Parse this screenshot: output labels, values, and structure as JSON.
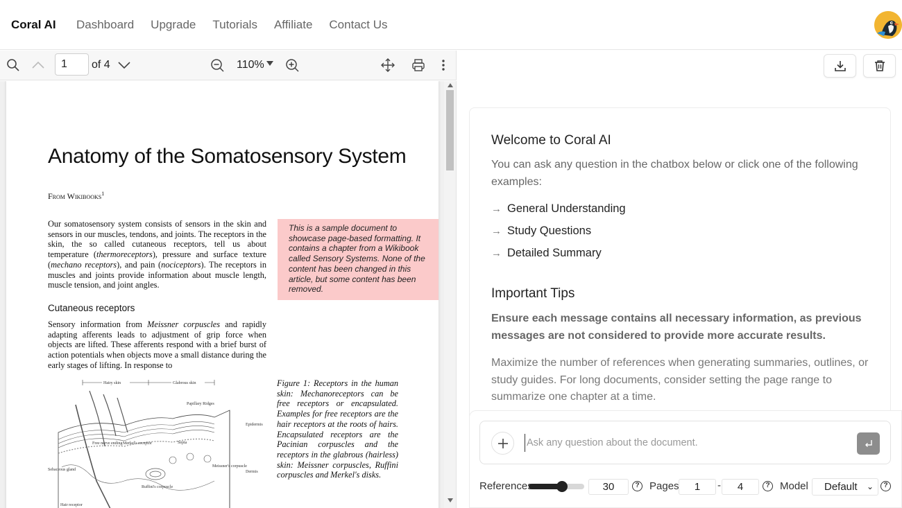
{
  "nav": {
    "brand": "Coral AI",
    "links": [
      "Dashboard",
      "Upgrade",
      "Tutorials",
      "Affiliate",
      "Contact Us"
    ]
  },
  "pdf_toolbar": {
    "page_value": "1",
    "page_total": "of 4",
    "zoom": "110%"
  },
  "document": {
    "title": "Anatomy of the Somatosensory System",
    "from": "From Wikibooks",
    "from_note": "1",
    "para1_a": "Our somatosensory system consists of sensors in the skin and sensors in our muscles, tendons, and joints. The receptors in the skin, the so called cutaneous receptors, tell us about temperature (",
    "para1_b": "thermoreceptors",
    "para1_c": "), pressure and surface texture (",
    "para1_d": "mechano receptors",
    "para1_e": "), and pain (",
    "para1_f": "nociceptors",
    "para1_g": "). The receptors in muscles and joints provide information about muscle length, muscle tension, and joint angles.",
    "heading": "Cutaneous receptors",
    "para2_a": "Sensory information from ",
    "para2_b": "Meissner corpuscles",
    "para2_c": " and rapidly adapting afferents leads to adjustment of grip force when objects are lifted. These afferents respond with a brief burst of action potentials when objects move a small distance during the early stages of lifting. In response to",
    "note": "This is a sample document to showcase page-based formatting. It contains a chapter from a Wikibook called Sensory Systems. None of the content has been changed in this article, but some content has been removed.",
    "caption": "Figure 1: Receptors in the human skin: Mechanoreceptors can be free receptors or encapsulated. Examples for free receptors are the hair receptors at the roots of hairs. Encapsulated receptors are the Pacinian corpuscles and the receptors in the glabrous (hairless) skin: Meissner corpuscles, Ruffini corpuscles and Merkel's disks.",
    "figure_labels": {
      "hairy": "Hairy skin",
      "glabrous": "Glabrous skin",
      "papillary": "Papillary Ridges",
      "free_nerve": "Free nerve ending",
      "merkel": "Merkel's receptor",
      "septa": "Septa",
      "epidermis": "Epidermis",
      "dermis": "Dermis",
      "meissner": "Meissner's corpuscle",
      "ruffini": "Ruffini's corpuscle",
      "sebaceous": "Sebaceous gland",
      "hair_receptor": "Hair receptor"
    }
  },
  "welcome": {
    "title": "Welcome to Coral AI",
    "subtitle": "You can ask any question in the chatbox below or click one of the following examples:",
    "examples": [
      "General Understanding",
      "Study Questions",
      "Detailed Summary"
    ],
    "tips_title": "Important Tips",
    "tip1": "Ensure each message contains all necessary information, as previous messages are not considered to provide more accurate results.",
    "tip2": "Maximize the number of references when generating summaries, outlines, or study guides. For long documents, consider setting the page range to summarize one chapter at a time."
  },
  "composer": {
    "placeholder": "Ask any question about the document.",
    "references_label": "References",
    "references_value": "30",
    "references_level": 0.6,
    "pages_label": "Pages",
    "page_from": "1",
    "page_to": "4",
    "model_label": "Model",
    "model_value": "Default"
  },
  "colors": {
    "note_bg": "#fbcaca",
    "avatar_bg": "#f2b531",
    "send_bg": "#8d8d8d"
  },
  "icons": [
    "search-icon",
    "chevron-up-icon",
    "chevron-down-icon",
    "zoom-out-icon",
    "zoom-in-icon",
    "move-icon",
    "print-icon",
    "more-vertical-icon",
    "download-icon",
    "trash-icon",
    "plus-icon",
    "enter-icon",
    "help-icon",
    "arrow-right-icon"
  ]
}
